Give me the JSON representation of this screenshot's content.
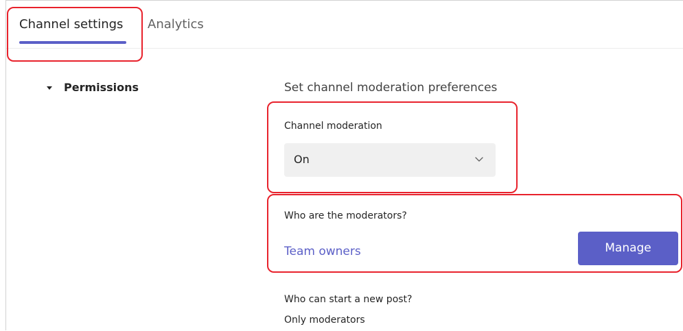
{
  "tabs": [
    {
      "label": "Channel settings",
      "active": true
    },
    {
      "label": "Analytics",
      "active": false
    }
  ],
  "permissions": {
    "section_title": "Permissions",
    "heading": "Set channel moderation preferences",
    "channel_moderation": {
      "label": "Channel moderation",
      "value": "On"
    },
    "moderators": {
      "label": "Who are the moderators?",
      "value_link": "Team owners",
      "manage_button": "Manage"
    },
    "new_post": {
      "label": "Who can start a new post?",
      "value": "Only moderators"
    }
  },
  "colors": {
    "accent": "#5b5fc7",
    "highlight": "#e8212b",
    "dropdown_bg": "#f0f0f0"
  },
  "icons": {
    "section_toggle": "caret-down-icon",
    "dropdown": "chevron-down-icon"
  }
}
